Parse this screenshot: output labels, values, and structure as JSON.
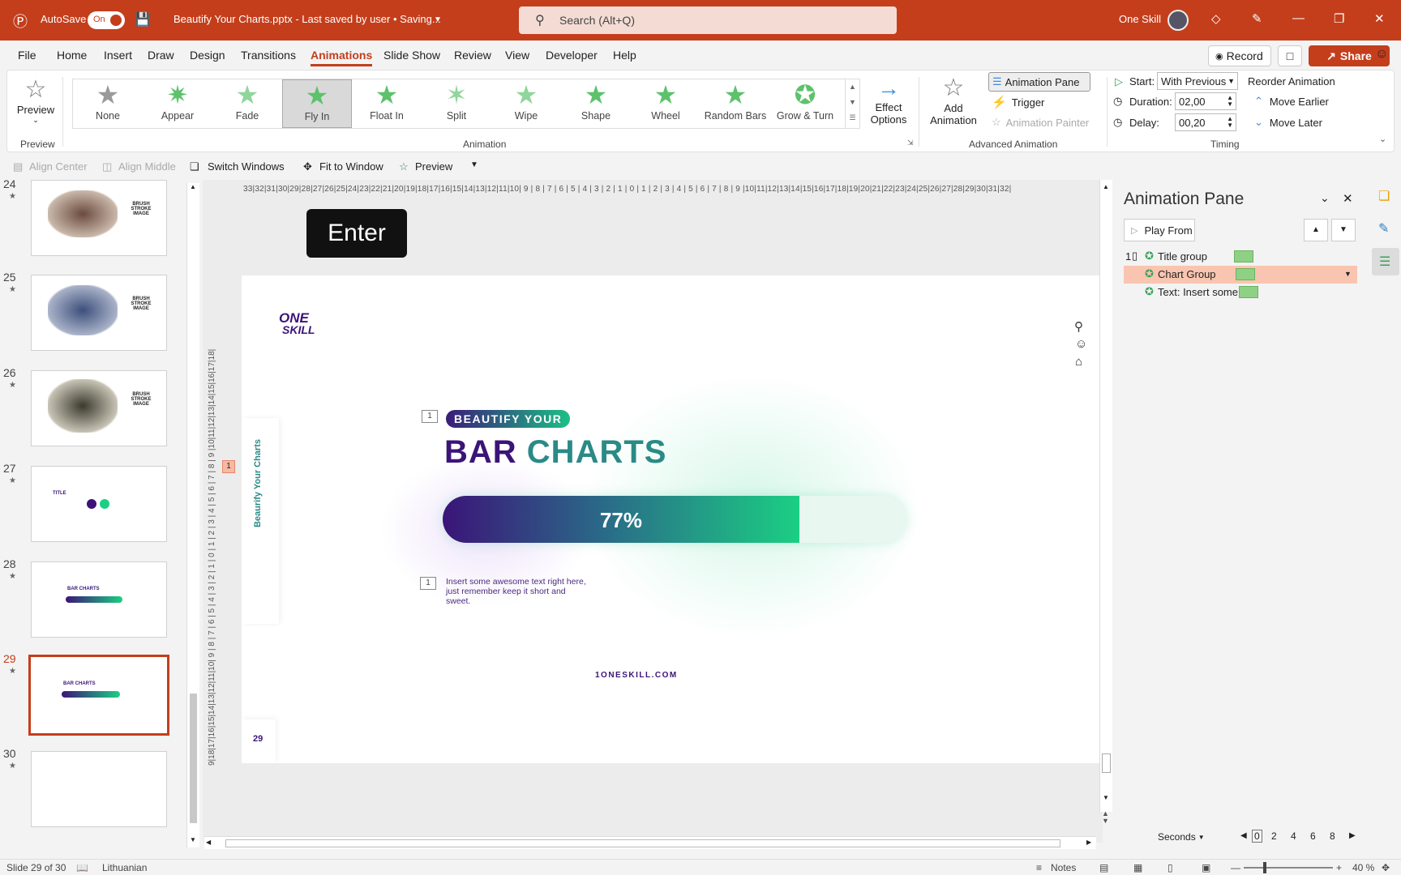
{
  "titlebar": {
    "autosave_label": "AutoSave",
    "autosave_state": "On",
    "doc_title": "Beautify Your Charts.pptx  -  Last saved by user • Saving...",
    "search_placeholder": "Search (Alt+Q)",
    "user_name": "One Skill"
  },
  "menu": {
    "items": [
      "File",
      "Home",
      "Insert",
      "Draw",
      "Design",
      "Transitions",
      "Animations",
      "Slide Show",
      "Review",
      "View",
      "Developer",
      "Help"
    ],
    "record_label": "Record",
    "share_label": "Share"
  },
  "ribbon": {
    "preview": {
      "label": "Preview",
      "group": "Preview"
    },
    "animations": [
      {
        "label": "None",
        "icon": "star-none-icon"
      },
      {
        "label": "Appear",
        "icon": "star-appear-icon"
      },
      {
        "label": "Fade",
        "icon": "star-fade-icon"
      },
      {
        "label": "Fly In",
        "icon": "star-fly-in-icon"
      },
      {
        "label": "Float In",
        "icon": "star-float-in-icon"
      },
      {
        "label": "Split",
        "icon": "star-split-icon"
      },
      {
        "label": "Wipe",
        "icon": "star-wipe-icon"
      },
      {
        "label": "Shape",
        "icon": "star-shape-icon"
      },
      {
        "label": "Wheel",
        "icon": "star-wheel-icon"
      },
      {
        "label": "Random Bars",
        "icon": "star-random-bars-icon"
      },
      {
        "label": "Grow & Turn",
        "icon": "star-grow-turn-icon"
      }
    ],
    "selected_animation": "Fly In",
    "effect_options": "Effect Options",
    "animation_group": "Animation",
    "add_animation": "Add Animation",
    "animation_pane": "Animation Pane",
    "trigger": "Trigger",
    "animation_painter": "Animation Painter",
    "advanced_group": "Advanced Animation",
    "start_label": "Start:",
    "start_value": "With Previous",
    "duration_label": "Duration:",
    "duration_value": "02,00",
    "delay_label": "Delay:",
    "delay_value": "00,20",
    "timing_group": "Timing",
    "reorder_title": "Reorder Animation",
    "move_earlier": "Move Earlier",
    "move_later": "Move Later"
  },
  "qat": {
    "align_center": "Align Center",
    "align_middle": "Align Middle",
    "switch_windows": "Switch Windows",
    "fit_to_window": "Fit to Window",
    "preview": "Preview"
  },
  "thumbnails": [
    {
      "num": "24",
      "text": "BRUSH STROKE IMAGE"
    },
    {
      "num": "25",
      "text": "BRUSH STROKE IMAGE"
    },
    {
      "num": "26",
      "text": "BRUSH STROKE IMAGE"
    },
    {
      "num": "27",
      "text": "TITLE"
    },
    {
      "num": "28",
      "text": "BAR CHARTS"
    },
    {
      "num": "29",
      "text": "BAR CHARTS"
    },
    {
      "num": "30",
      "text": ""
    }
  ],
  "editor": {
    "keystroke_overlay": "Enter",
    "ruler_h": "33|32|31|30|29|28|27|26|25|24|23|22|21|20|19|18|17|16|15|14|13|12|11|10| 9 | 8 | 7 | 6 | 5 | 4 | 3 | 2 | 1 | 0 | 1 | 2 | 3 | 4 | 5 | 6 | 7 | 8 | 9 |10|11|12|13|14|15|16|17|18|19|20|21|22|23|24|25|26|27|28|29|30|31|32|",
    "ruler_v": "9|18|17|16|15|14|13|12|11|10| 9 | 8 | 7 | 6 | 5 | 4 | 3 | 2 | 1 | 0 | 1 | 2 | 3 | 4 | 5 | 6 | 7 | 8 | 9 |10|11|12|13|14|15|16|17|18|",
    "ruler_marker": "1"
  },
  "slide": {
    "logo_top": "ONE",
    "logo_bottom": "SKILL",
    "side_label": "Beaurify Your Charts",
    "anim_tag_title": "1",
    "anim_tag_text": "1",
    "pill_text": "BEAUTIFY YOUR",
    "title_part1": "BAR",
    "title_part2": "CHARTS",
    "bar_label": "77%",
    "bar_value": 0.77,
    "body_text": "Insert some awesome text right here, just remember keep it short and sweet.",
    "page_number": "29",
    "footer_url": "1ONESKILL.COM",
    "colors": {
      "purple": "#3b1478",
      "green": "#1bcf83",
      "teal": "#2a8a86"
    }
  },
  "animation_pane": {
    "title": "Animation Pane",
    "play_from": "Play From",
    "items": [
      {
        "order": "1",
        "label": "Title group",
        "selected": false
      },
      {
        "order": "",
        "label": "Chart Group",
        "selected": true
      },
      {
        "order": "",
        "label": "Text: Insert some...",
        "selected": false
      }
    ],
    "seconds_label": "Seconds",
    "timeline_ticks": [
      "0",
      "2",
      "4",
      "6",
      "8"
    ]
  },
  "statusbar": {
    "slide_info": "Slide 29 of 30",
    "language": "Lithuanian",
    "notes": "Notes",
    "zoom": "40 %"
  }
}
